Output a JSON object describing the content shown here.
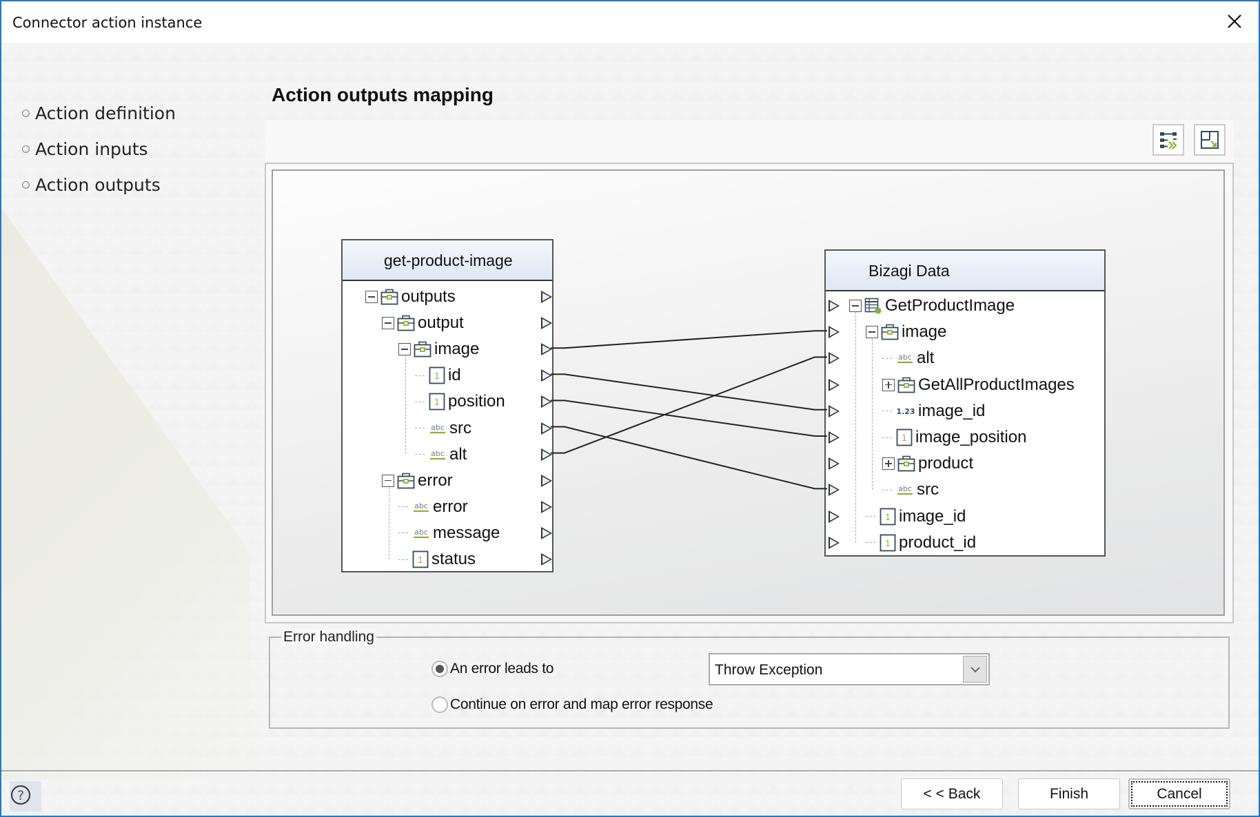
{
  "window": {
    "title": "Connector action instance"
  },
  "sidebar": {
    "items": [
      {
        "label": "Action definition"
      },
      {
        "label": "Action inputs"
      },
      {
        "label": "Action outputs"
      }
    ]
  },
  "main": {
    "heading": "Action outputs mapping",
    "toolbar": [
      {
        "icon": "auto-map-icon",
        "tooltip": ""
      },
      {
        "icon": "fit-view-icon",
        "tooltip": ""
      }
    ]
  },
  "mapping": {
    "source": {
      "title": "get-product-image",
      "rows": [
        {
          "label": "outputs",
          "type": "object",
          "level": 0,
          "expander": "minus"
        },
        {
          "label": "output",
          "type": "object",
          "level": 1,
          "expander": "minus"
        },
        {
          "label": "image",
          "type": "object",
          "level": 2,
          "expander": "minus"
        },
        {
          "label": "id",
          "type": "integer",
          "level": 3
        },
        {
          "label": "position",
          "type": "integer",
          "level": 3
        },
        {
          "label": "src",
          "type": "string",
          "level": 3
        },
        {
          "label": "alt",
          "type": "string",
          "level": 3
        },
        {
          "label": "error",
          "type": "object",
          "level": 1,
          "expander": "minus"
        },
        {
          "label": "error",
          "type": "string",
          "level": 2
        },
        {
          "label": "message",
          "type": "string",
          "level": 2
        },
        {
          "label": "status",
          "type": "integer",
          "level": 2
        }
      ]
    },
    "target": {
      "title": "Bizagi Data",
      "rows": [
        {
          "label": "GetProductImage",
          "type": "entity",
          "level": 0,
          "expander": "minus"
        },
        {
          "label": "image",
          "type": "object",
          "level": 1,
          "expander": "minus"
        },
        {
          "label": "alt",
          "type": "string",
          "level": 2
        },
        {
          "label": "GetAllProductImages",
          "type": "object",
          "level": 2,
          "expander": "plus"
        },
        {
          "label": "image_id",
          "type": "decimal",
          "level": 2
        },
        {
          "label": "image_position",
          "type": "integer",
          "level": 2
        },
        {
          "label": "product",
          "type": "object",
          "level": 2,
          "expander": "plus"
        },
        {
          "label": "src",
          "type": "string",
          "level": 2
        },
        {
          "label": "image_id",
          "type": "integer",
          "level": 1
        },
        {
          "label": "product_id",
          "type": "integer",
          "level": 1
        }
      ]
    },
    "links": [
      {
        "from": "image",
        "to": "image"
      },
      {
        "from": "id",
        "to": "image_id"
      },
      {
        "from": "position",
        "to": "image_position"
      },
      {
        "from": "src",
        "to": "src"
      },
      {
        "from": "alt",
        "to": "alt"
      }
    ],
    "type_glyphs": {
      "integer": "1",
      "decimal": "1.23",
      "string": "abc"
    }
  },
  "error_handling": {
    "title": "Error handling",
    "options": [
      {
        "label": "An error leads to",
        "checked": true
      },
      {
        "label": "Continue on error and map error response",
        "checked": false
      }
    ],
    "action": {
      "selected": "Throw Exception"
    }
  },
  "footer": {
    "help_icon": "help-icon",
    "back_label": "< < Back",
    "finish_label": "Finish",
    "cancel_label": "Cancel"
  },
  "colors": {
    "accent_border": "#1f7ac8",
    "type_green": "#8db32b",
    "icon_navy": "#34495e"
  }
}
